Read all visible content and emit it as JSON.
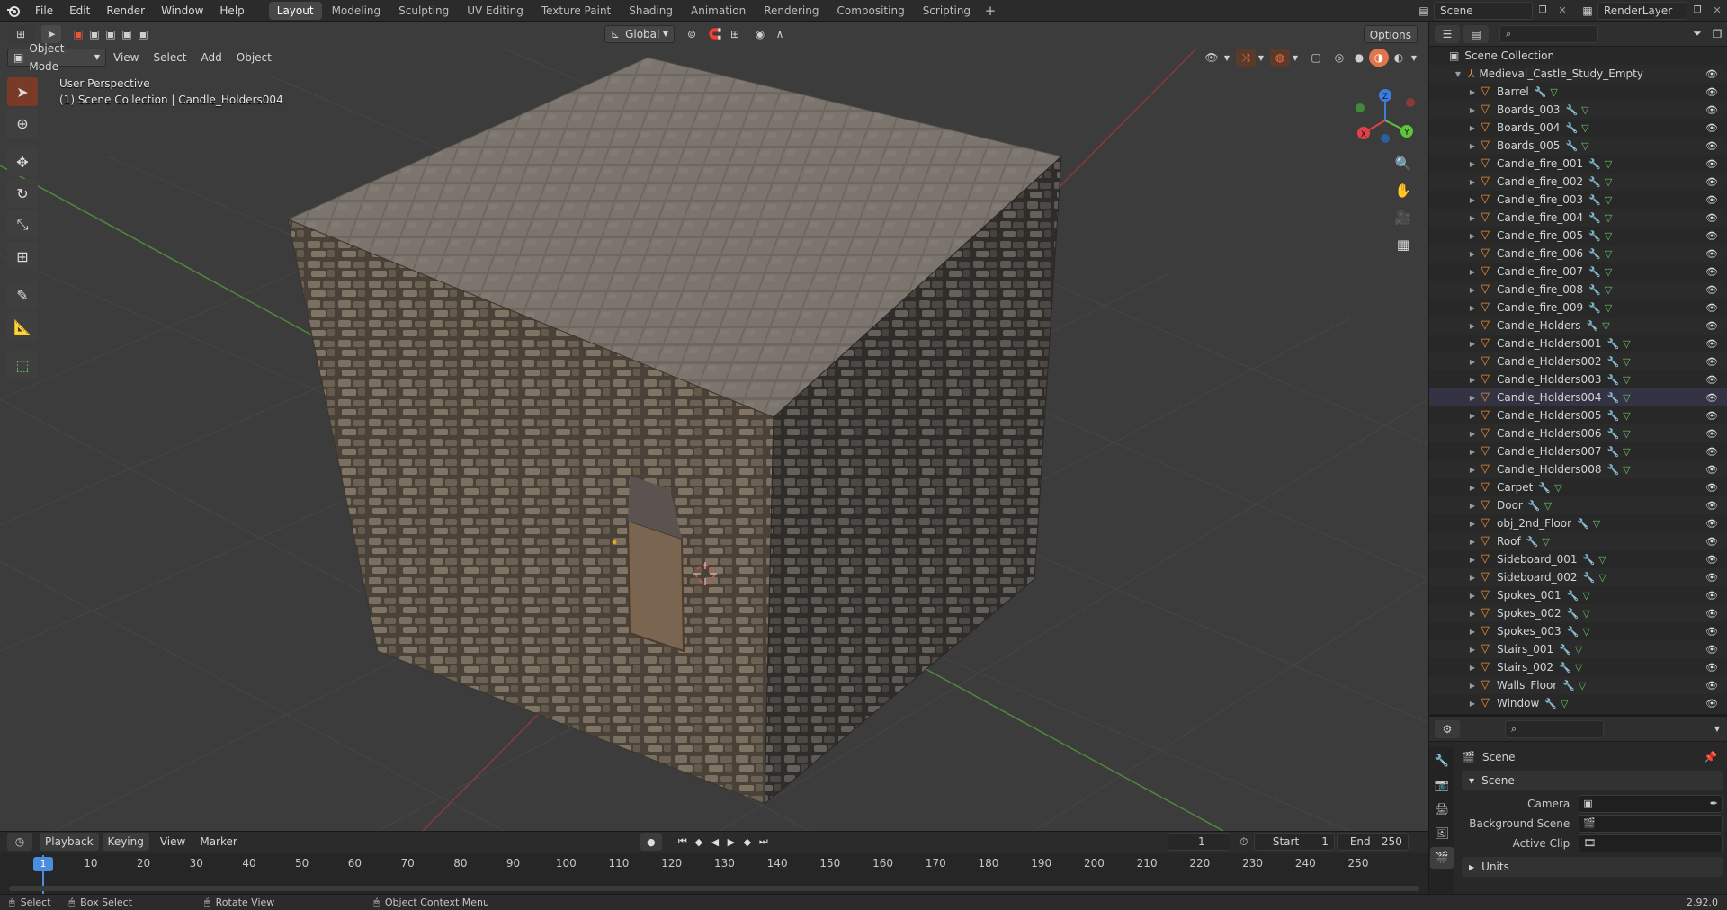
{
  "topbar": {
    "menus": [
      "File",
      "Edit",
      "Render",
      "Window",
      "Help"
    ],
    "workspaces": [
      "Layout",
      "Modeling",
      "Sculpting",
      "UV Editing",
      "Texture Paint",
      "Shading",
      "Animation",
      "Rendering",
      "Compositing",
      "Scripting"
    ],
    "active_workspace": "Layout",
    "add_tab_icon": "plus-icon",
    "scene_name": "Scene",
    "render_layer": "RenderLayer"
  },
  "viewport": {
    "mode": "Object Mode",
    "menus": [
      "View",
      "Select",
      "Add",
      "Object"
    ],
    "transform_orientation": "Global",
    "options_label": "Options",
    "perspective_label": "User Perspective",
    "context_label": "(1) Scene Collection | Candle_Holders004",
    "gizmo_axes": [
      "X",
      "Y",
      "Z"
    ],
    "axis_colors": {
      "x": "#e0424a",
      "y": "#5ec43a",
      "z": "#3d7de0"
    }
  },
  "outliner": {
    "root": "Scene Collection",
    "collection": "Medieval_Castle_Study_Empty",
    "items": [
      "Barrel",
      "Boards_003",
      "Boards_004",
      "Boards_005",
      "Candle_fire_001",
      "Candle_fire_002",
      "Candle_fire_003",
      "Candle_fire_004",
      "Candle_fire_005",
      "Candle_fire_006",
      "Candle_fire_007",
      "Candle_fire_008",
      "Candle_fire_009",
      "Candle_Holders",
      "Candle_Holders001",
      "Candle_Holders002",
      "Candle_Holders003",
      "Candle_Holders004",
      "Candle_Holders005",
      "Candle_Holders006",
      "Candle_Holders007",
      "Candle_Holders008",
      "Carpet",
      "Door",
      "obj_2nd_Floor",
      "Roof",
      "Sideboard_001",
      "Sideboard_002",
      "Spokes_001",
      "Spokes_002",
      "Spokes_003",
      "Stairs_001",
      "Stairs_002",
      "Walls_Floor",
      "Window"
    ],
    "active_item": "Candle_Holders004"
  },
  "properties": {
    "context": "Scene",
    "panel": "Scene",
    "camera_label": "Camera",
    "background_scene_label": "Background Scene",
    "active_clip_label": "Active Clip",
    "units_panel": "Units"
  },
  "timeline": {
    "menus": [
      "Playback",
      "Keying",
      "View",
      "Marker"
    ],
    "current_frame": "1",
    "start_label": "Start",
    "start_value": "1",
    "end_label": "End",
    "end_value": "250",
    "ruler": [
      "1",
      "10",
      "20",
      "30",
      "40",
      "50",
      "60",
      "70",
      "80",
      "90",
      "100",
      "110",
      "120",
      "130",
      "140",
      "150",
      "160",
      "170",
      "180",
      "190",
      "200",
      "210",
      "220",
      "230",
      "240",
      "250"
    ]
  },
  "statusbar": {
    "select": "Select",
    "box_select": "Box Select",
    "rotate_view": "Rotate View",
    "context_menu": "Object Context Menu",
    "version": "2.92.0"
  }
}
